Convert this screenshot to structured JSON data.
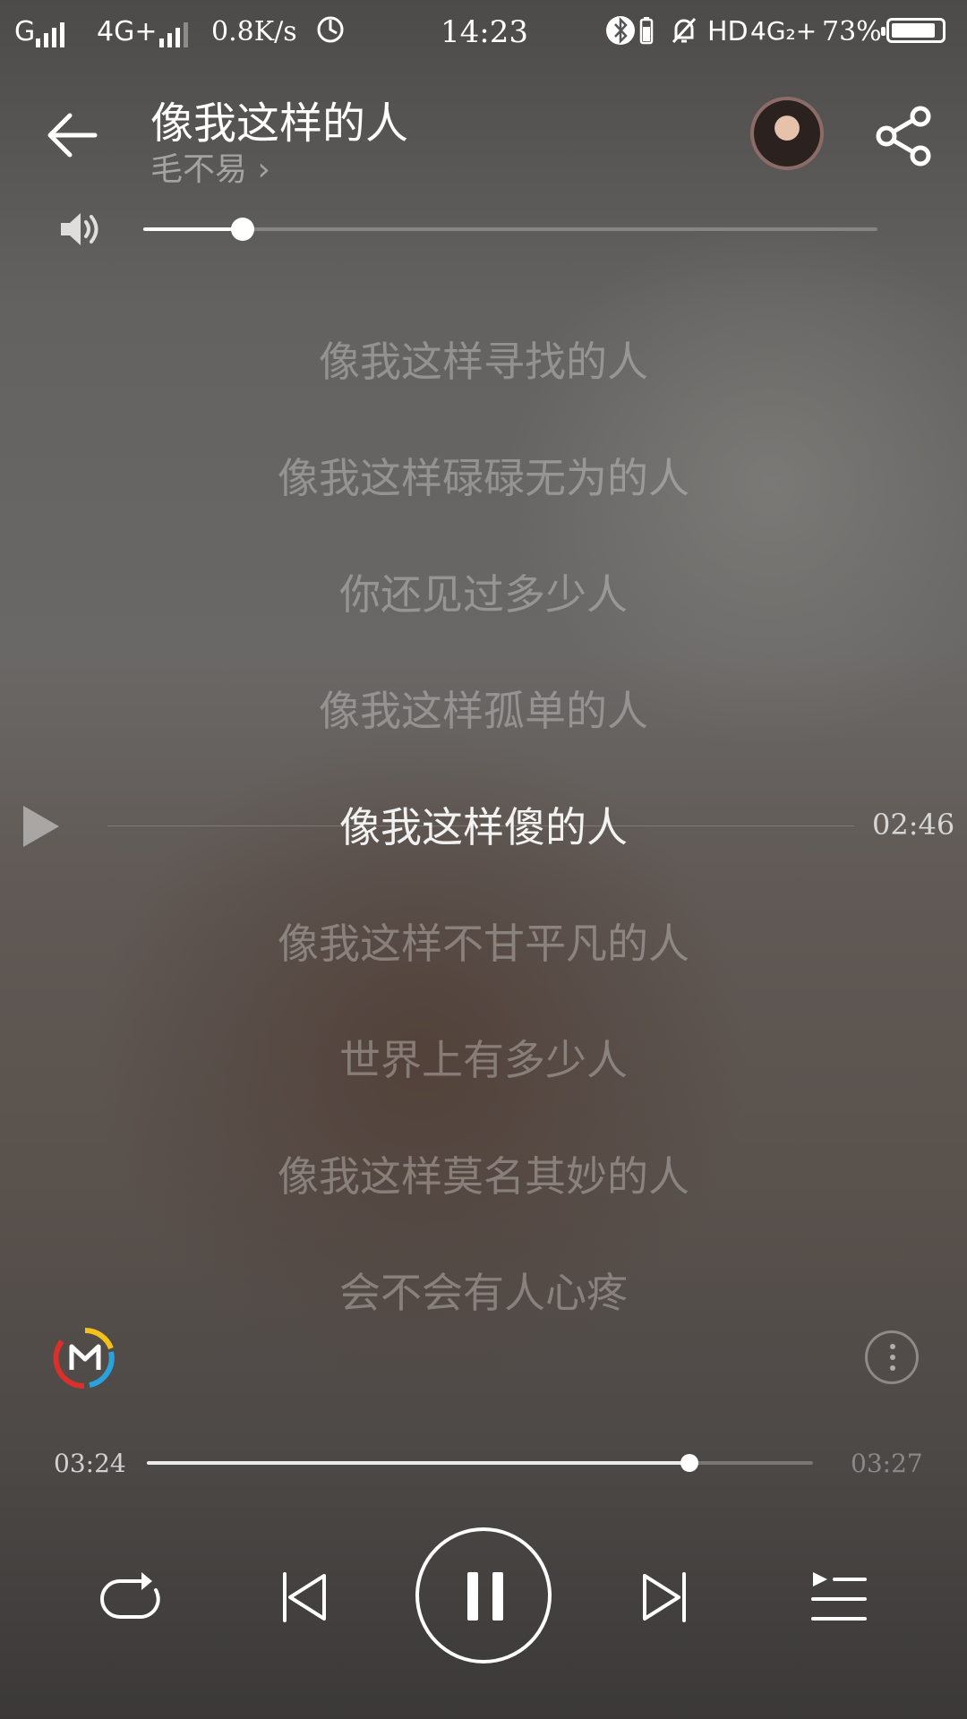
{
  "status_bar": {
    "carrier_1": "G",
    "carrier_2": "4G+",
    "net_speed": "0.8K/s",
    "time": "14:23",
    "hd": "HD",
    "network_right": "4G₂+",
    "battery_percent": "73%"
  },
  "player": {
    "title": "像我这样的人",
    "artist": "毛不易",
    "artist_chevron": "›",
    "volume_level": 0.135,
    "lyrics": [
      "像我这样寻找的人",
      "像我这样碌碌无为的人",
      "你还见过多少人",
      "像我这样孤单的人",
      "像我这样傻的人",
      "像我这样不甘平凡的人",
      "世界上有多少人",
      "像我这样莫名其妙的人",
      "会不会有人心疼"
    ],
    "current_lyric_index": 4,
    "seek_time": "02:46",
    "elapsed": "03:24",
    "total": "03:27",
    "progress": 0.815
  },
  "icons": {
    "back": "arrow-left-icon",
    "share": "share-icon",
    "volume": "speaker-icon",
    "play": "play-icon",
    "more": "more-vertical-icon",
    "repeat": "repeat-icon",
    "previous": "skip-previous-icon",
    "pause": "pause-icon",
    "next": "skip-next-icon",
    "playlist": "playlist-icon",
    "brand": "m-logo-icon"
  },
  "colors": {
    "text": "#ffffff",
    "logo_yellow": "#f3c21a",
    "logo_red": "#d9302b",
    "logo_blue": "#2aa3dc"
  }
}
